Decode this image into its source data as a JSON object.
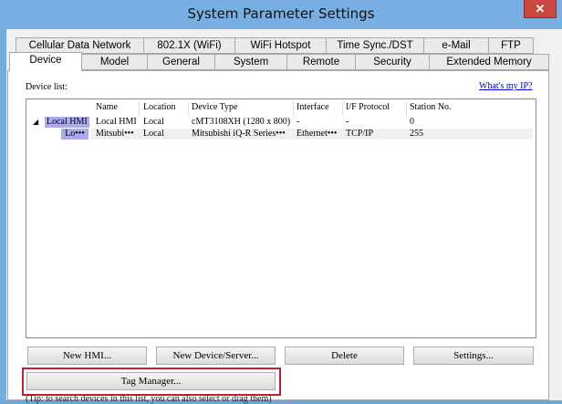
{
  "window": {
    "title": "System Parameter Settings",
    "close_label": "✕"
  },
  "tabs_row1": [
    {
      "label": "Cellular Data Network"
    },
    {
      "label": "802.1X (WiFi)"
    },
    {
      "label": "WiFi Hotspot"
    },
    {
      "label": "Time Sync./DST"
    },
    {
      "label": "e-Mail"
    },
    {
      "label": "FTP"
    }
  ],
  "tabs_row2": [
    {
      "label": "Device",
      "active": true
    },
    {
      "label": "Model"
    },
    {
      "label": "General"
    },
    {
      "label": "System"
    },
    {
      "label": "Remote"
    },
    {
      "label": "Security"
    },
    {
      "label": "Extended Memory"
    }
  ],
  "device_panel": {
    "list_label": "Device list:",
    "help_link": "What's my IP?",
    "columns": [
      "Name",
      "Location",
      "Device Type",
      "Interface",
      "I/F Protocol",
      "Station No."
    ],
    "rows": [
      {
        "node": "Local HMI",
        "name": "Local HMI",
        "location": "Local",
        "device_type": "cMT3108XH (1280 x 800)",
        "interface": "-",
        "protocol": "-",
        "station": "0"
      },
      {
        "node": "Lo•••",
        "name": "Mitsubi•••",
        "location": "Local",
        "device_type": "Mitsubishi iQ-R Series•••",
        "interface": "Ethernet•••",
        "protocol": "TCP/IP",
        "station": "255"
      }
    ],
    "buttons": {
      "new_hmi": "New HMI...",
      "new_device": "New Device/Server...",
      "delete": "Delete",
      "settings": "Settings...",
      "tag_manager": "Tag Manager..."
    },
    "footer_text": "(Tip: to search devices in this list, you can also select or drag them)"
  }
}
